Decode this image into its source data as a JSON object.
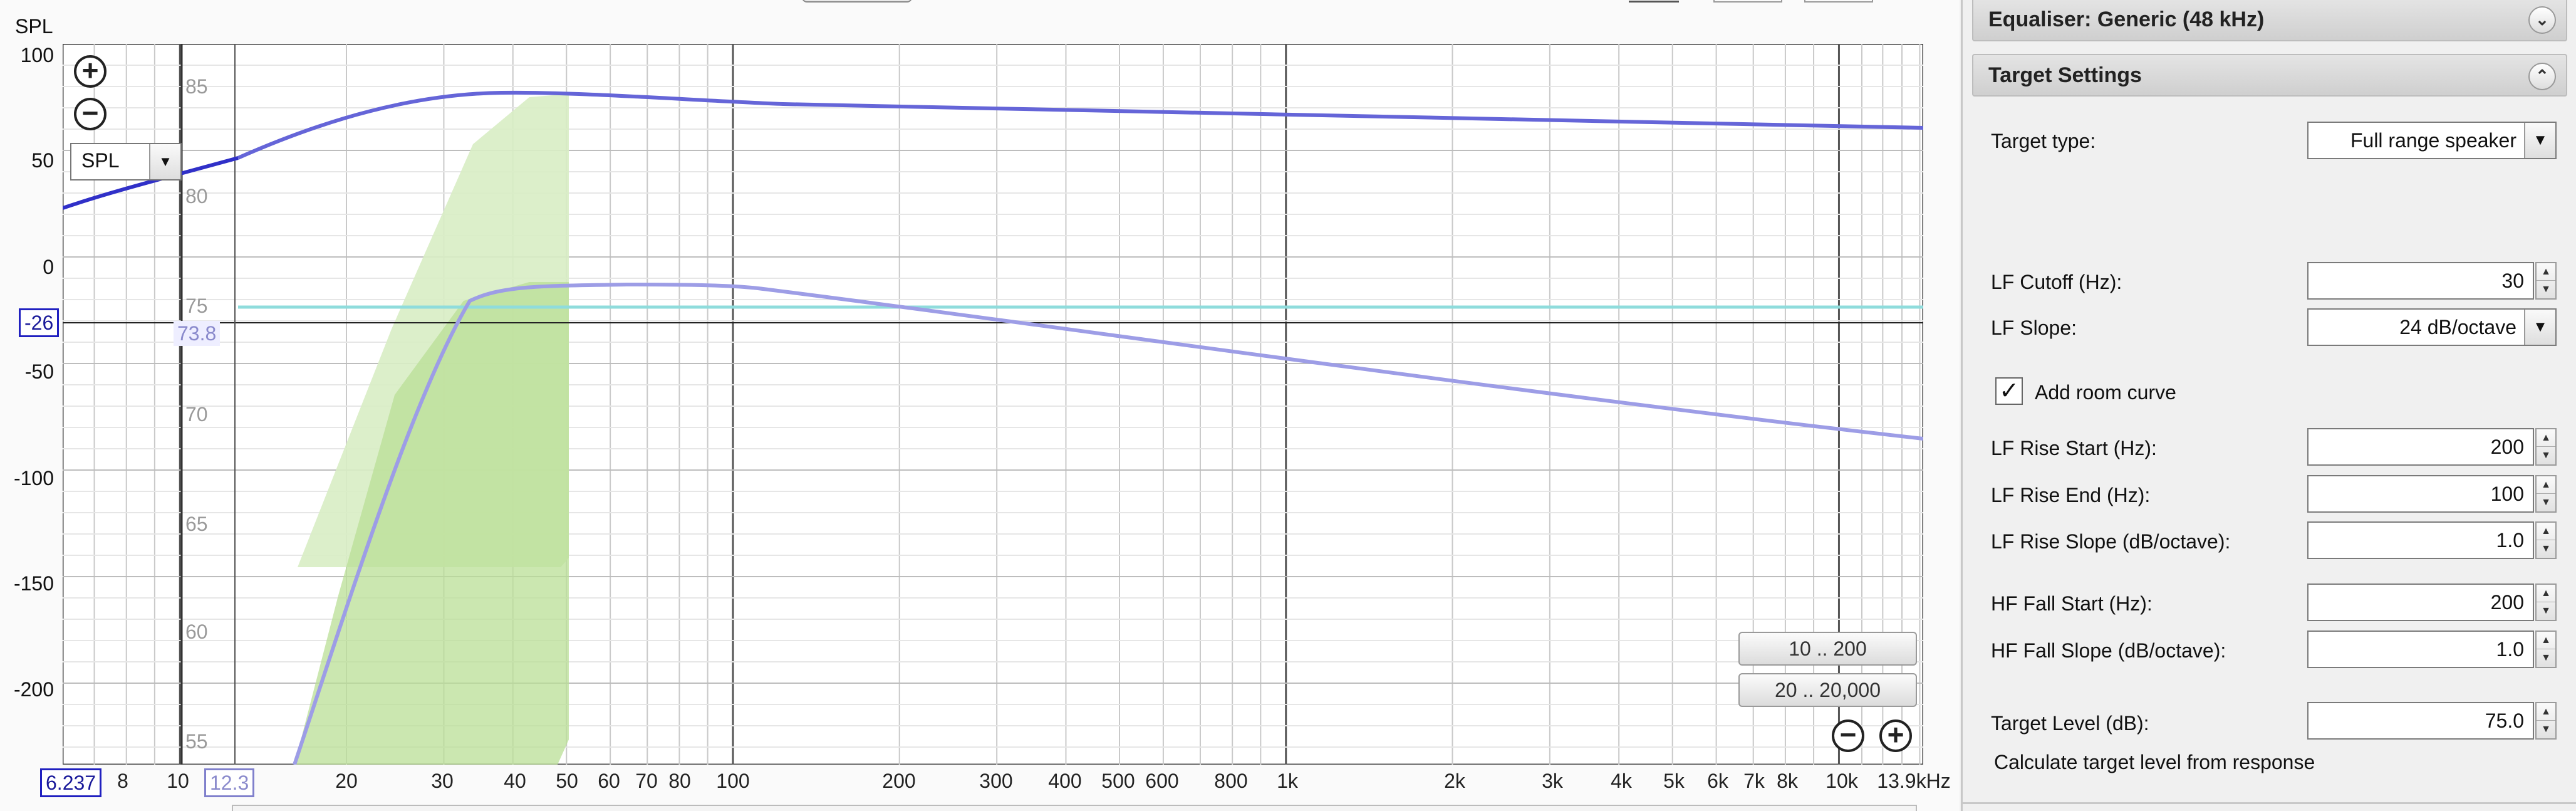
{
  "graph": {
    "y_axis_title": "SPL",
    "left_ticks": [
      "100",
      "50",
      "0",
      "-50",
      "-100",
      "-150",
      "-200"
    ],
    "right_ticks": [
      "85",
      "80",
      "75",
      "70",
      "65",
      "60",
      "55"
    ],
    "x_ticks": [
      "20",
      "30",
      "40",
      "50",
      "60",
      "70",
      "80",
      "100",
      "200",
      "300",
      "400",
      "500",
      "600",
      "800",
      "1k",
      "2k",
      "3k",
      "4k",
      "5k",
      "6k",
      "7k",
      "8k",
      "10k",
      "13.9kHz"
    ],
    "x_extra_ticks": [
      "8",
      "10"
    ],
    "measure_combo": "SPL",
    "cursor_left_value": "-26",
    "cursor_right_value": "73.8",
    "cursor_x_left_value": "6.237",
    "cursor_x_value": "12.3",
    "range_btn_1": "10 .. 200",
    "range_btn_2": "20 .. 20,000",
    "zoom_in_symbol": "+",
    "zoom_out_symbol": "−"
  },
  "colors": {
    "upper_curve": "#6565d8",
    "lower_curve": "#9d9de6",
    "target_line": "#8fdcdc",
    "shade_light": "#d8edc4",
    "shade_dark": "#bfe39f",
    "dark_curve": "#3030c8"
  },
  "panel": {
    "equaliser": {
      "title": "Equaliser: Generic (48 kHz)",
      "icon": "double-chevron-down-icon"
    },
    "target_settings": {
      "title": "Target Settings",
      "icon": "double-chevron-up-icon"
    },
    "target_type": {
      "label": "Target type:",
      "value": "Full range speaker"
    },
    "lf_cutoff": {
      "label": "LF Cutoff (Hz):",
      "value": "30"
    },
    "lf_slope": {
      "label": "LF Slope:",
      "value": "24 dB/octave"
    },
    "add_room_curve": {
      "label": "Add room curve",
      "checked": true
    },
    "lf_rise_start": {
      "label": "LF Rise Start (Hz):",
      "value": "200"
    },
    "lf_rise_end": {
      "label": "LF Rise End (Hz):",
      "value": "100"
    },
    "lf_rise_slope": {
      "label": "LF Rise Slope (dB/octave):",
      "value": "1.0"
    },
    "hf_fall_start": {
      "label": "HF Fall Start (Hz):",
      "value": "200"
    },
    "hf_fall_slope": {
      "label": "HF Fall Slope (dB/octave):",
      "value": "1.0"
    },
    "target_level": {
      "label": "Target Level (dB):",
      "value": "75.0"
    },
    "calc_link": "Calculate target level from response"
  }
}
